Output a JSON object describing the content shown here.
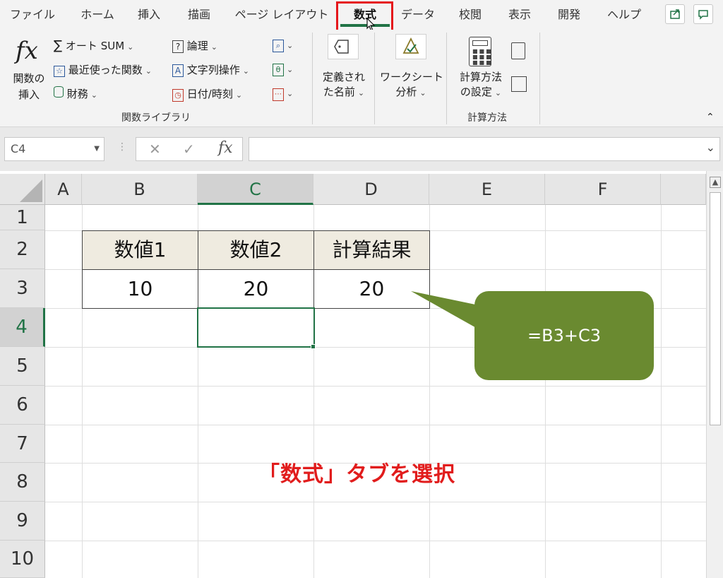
{
  "menu": {
    "tabs": [
      "ファイル",
      "ホーム",
      "挿入",
      "描画",
      "ページ レイアウト",
      "数式",
      "データ",
      "校閲",
      "表示",
      "開発",
      "ヘルプ"
    ],
    "active_tab": "数式"
  },
  "ribbon": {
    "insert_function": {
      "line1": "関数の",
      "line2": "挿入"
    },
    "autosum": "オート SUM",
    "recent": "最近使った関数",
    "financial": "財務",
    "logical": "論理",
    "text": "文字列操作",
    "datetime": "日付/時刻",
    "group_library": "関数ライブラリ",
    "defined_names": {
      "line1": "定義され",
      "line2": "た名前"
    },
    "formula_audit": {
      "line1": "ワークシート",
      "line2": "分析"
    },
    "calc_options": {
      "line1": "計算方法",
      "line2": "の設定"
    },
    "group_calc": "計算方法"
  },
  "formula_bar": {
    "name_box": "C4",
    "fx": "fx",
    "formula": ""
  },
  "sheet": {
    "columns": [
      "A",
      "B",
      "C",
      "D",
      "E",
      "F"
    ],
    "rows": [
      "1",
      "2",
      "3",
      "4",
      "5",
      "6",
      "7",
      "8",
      "9",
      "10"
    ],
    "selected_cell": "C4",
    "cells": {
      "B2": "数値1",
      "C2": "数値2",
      "D2": "計算結果",
      "B3": "10",
      "C3": "20",
      "D3": "20"
    }
  },
  "callout": "=B3+C3",
  "caption": "「数式」タブを選択",
  "colors": {
    "accent": "#217346",
    "highlight": "#e5161b",
    "callout": "#6a8a30",
    "caption": "#e11c1c",
    "header_fill": "#efebe0"
  }
}
